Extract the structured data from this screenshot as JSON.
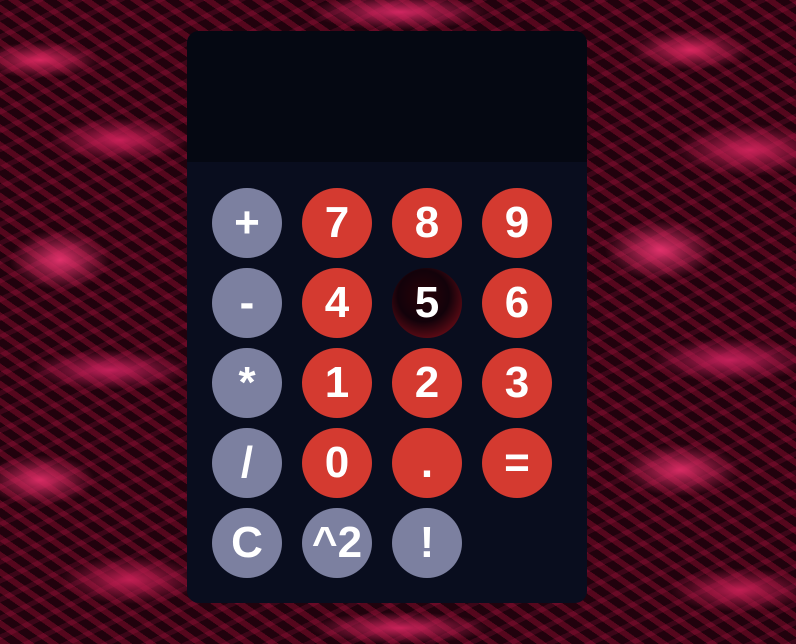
{
  "display": {
    "value": ""
  },
  "keys": {
    "plus": "+",
    "seven": "7",
    "eight": "8",
    "nine": "9",
    "minus": "-",
    "four": "4",
    "five": "5",
    "six": "6",
    "multiply": "*",
    "one": "1",
    "two": "2",
    "three": "3",
    "divide": "/",
    "zero": "0",
    "decimal": ".",
    "equals": "=",
    "clear": "C",
    "square": "^2",
    "factorial": "!"
  },
  "colors": {
    "display_background": "#050812",
    "keypad_background": "#090d1e",
    "number_key": "#d43a30",
    "operator_key": "#7c80a0",
    "background_accent": "#d8265e"
  }
}
